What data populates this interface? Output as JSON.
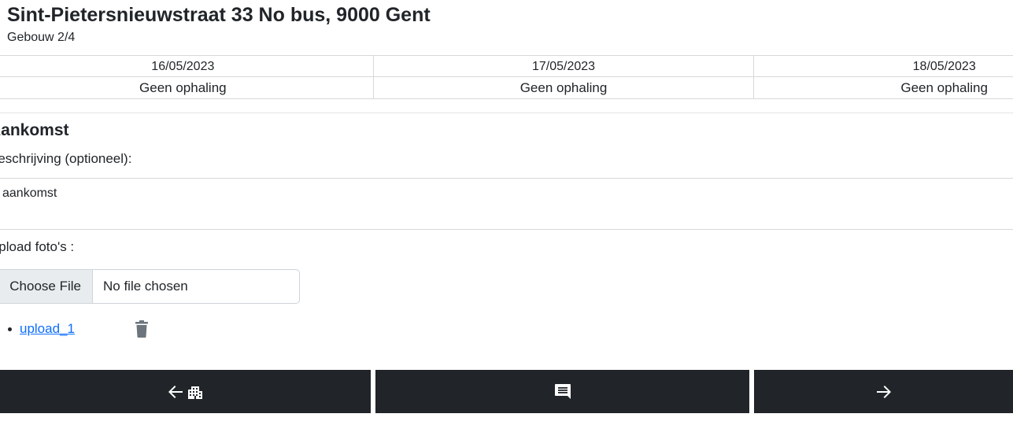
{
  "header": {
    "title": "Sint-Pietersnieuwstraat 33 No bus, 9000 Gent",
    "subtitle": "Gebouw 2/4"
  },
  "schedule": {
    "days": [
      {
        "date": "16/05/2023",
        "status": "Geen ophaling"
      },
      {
        "date": "17/05/2023",
        "status": "Geen ophaling"
      },
      {
        "date": "18/05/2023",
        "status": "Geen ophaling"
      }
    ]
  },
  "form": {
    "heading": "Aankomst",
    "description_label": "Beschrijving (optioneel):",
    "description_value": "aankomst",
    "upload_label": "Upload foto's :",
    "file_button": "Choose File",
    "file_status": "No file chosen"
  },
  "uploads": [
    {
      "name": "upload_1"
    }
  ],
  "icons": {
    "trash": "trash-icon",
    "back": "arrow-left-icon",
    "building": "building-icon",
    "comment": "comment-icon",
    "next": "arrow-right-icon"
  },
  "colors": {
    "navbar": "#212529",
    "link": "#0d6efd",
    "trash": "#6c757d"
  }
}
